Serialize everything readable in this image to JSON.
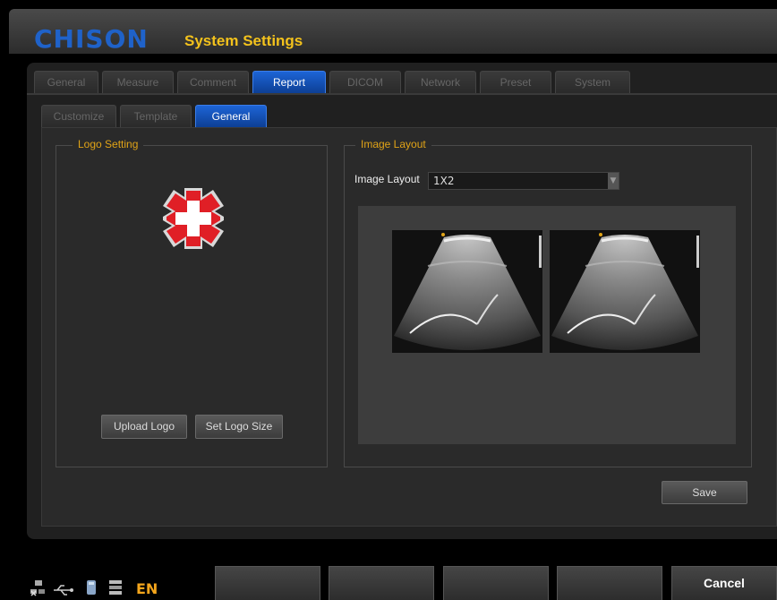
{
  "app": {
    "brand": "CHISON",
    "title": "System Settings"
  },
  "main_tabs": [
    {
      "label": "General",
      "active": false
    },
    {
      "label": "Measure",
      "active": false
    },
    {
      "label": "Comment",
      "active": false
    },
    {
      "label": "Report",
      "active": true
    },
    {
      "label": "DICOM",
      "active": false
    },
    {
      "label": "Network",
      "active": false
    },
    {
      "label": "Preset",
      "active": false
    },
    {
      "label": "System",
      "active": false
    }
  ],
  "sub_tabs": [
    {
      "label": "Customize",
      "active": false
    },
    {
      "label": "Template",
      "active": false
    },
    {
      "label": "General",
      "active": true
    }
  ],
  "logo_setting": {
    "legend": "Logo Setting",
    "upload_label": "Upload Logo",
    "size_label": "Set Logo Size"
  },
  "image_layout": {
    "legend": "Image Layout",
    "field_label": "Image Layout",
    "selected": "1X2"
  },
  "save_label": "Save",
  "softkeys": [
    "",
    "",
    "",
    "",
    "Cancel"
  ],
  "status": {
    "language": "EN"
  },
  "colors": {
    "accent": "#f3c21c",
    "active_tab": "#1d64d6",
    "brand": "#1f62c9"
  }
}
